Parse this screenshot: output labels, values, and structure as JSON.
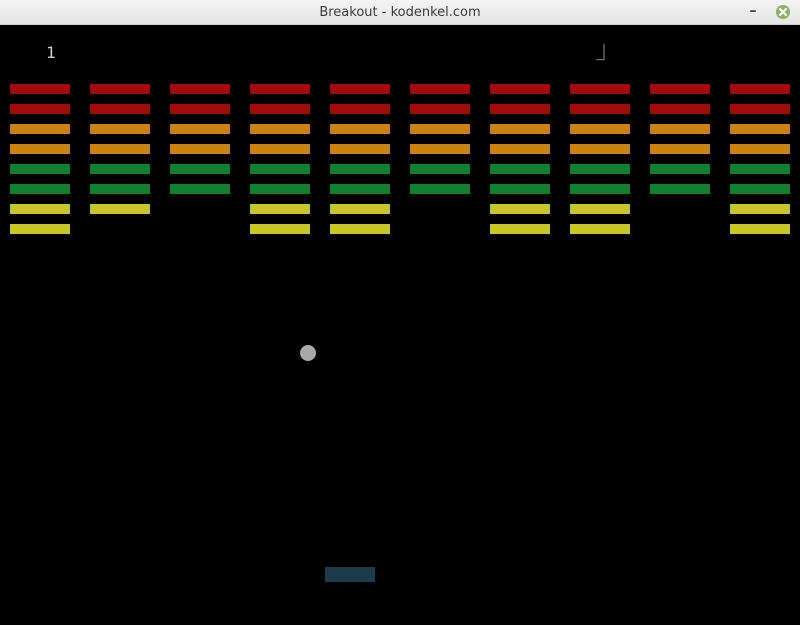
{
  "window": {
    "title": "Breakout - kodenkel.com",
    "minimize_label": "–"
  },
  "hud": {
    "score_left": "1",
    "score_right": "⏌"
  },
  "colors": {
    "background": "#000000",
    "red": "#a30a0a",
    "orange": "#c9810f",
    "green": "#10802e",
    "yellow": "#c9c524",
    "ball": "#a9a9a9",
    "paddle": "#1b3a4c"
  },
  "bricks": {
    "columns": 10,
    "row_colors": [
      "red",
      "red",
      "orange",
      "orange",
      "green",
      "green",
      "yellow",
      "yellow"
    ],
    "present": [
      [
        1,
        1,
        1,
        1,
        1,
        1,
        1,
        1,
        1,
        1
      ],
      [
        1,
        1,
        1,
        1,
        1,
        1,
        1,
        1,
        1,
        1
      ],
      [
        1,
        1,
        1,
        1,
        1,
        1,
        1,
        1,
        1,
        1
      ],
      [
        1,
        1,
        1,
        1,
        1,
        1,
        1,
        1,
        1,
        1
      ],
      [
        1,
        1,
        1,
        1,
        1,
        1,
        1,
        1,
        1,
        1
      ],
      [
        1,
        1,
        1,
        1,
        1,
        1,
        1,
        1,
        1,
        1
      ],
      [
        1,
        1,
        0,
        1,
        1,
        0,
        1,
        1,
        0,
        1
      ],
      [
        1,
        0,
        0,
        1,
        1,
        0,
        1,
        1,
        0,
        1
      ]
    ]
  }
}
